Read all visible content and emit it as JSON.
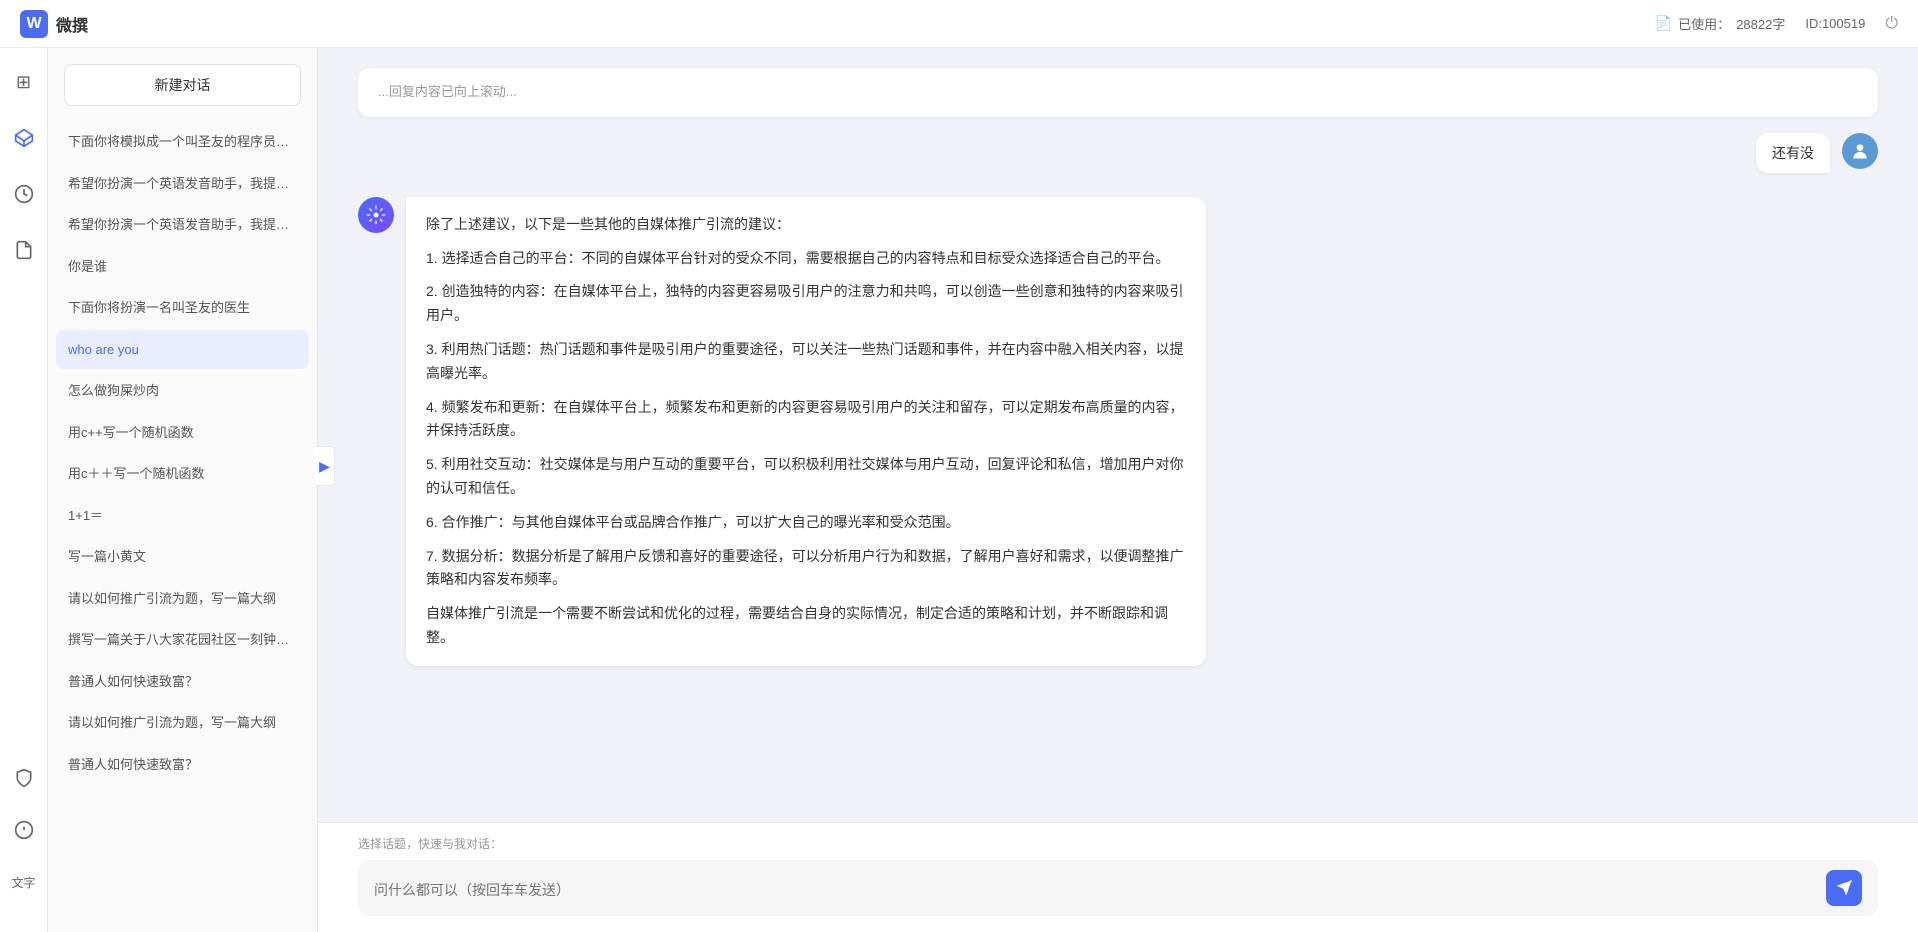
{
  "header": {
    "title": "微撰",
    "logo_letter": "W",
    "usage_label": "已使用：",
    "usage_value": "28822字",
    "id_label": "ID:100519"
  },
  "sidebar_icons": {
    "top": [
      {
        "name": "home-icon",
        "symbol": "⊞"
      },
      {
        "name": "cube-icon",
        "symbol": "◈"
      },
      {
        "name": "clock-icon",
        "symbol": "⏱"
      },
      {
        "name": "doc-icon",
        "symbol": "📄"
      }
    ],
    "bottom": [
      {
        "name": "shield-icon",
        "symbol": "🛡"
      },
      {
        "name": "info-icon",
        "symbol": "ℹ"
      },
      {
        "name": "bottom-text",
        "symbol": "文字"
      }
    ]
  },
  "conv_sidebar": {
    "new_btn": "新建对话",
    "items": [
      {
        "text": "下面你将模拟成一个叫圣友的程序员，我说...",
        "active": false
      },
      {
        "text": "希望你扮演一个英语发音助手，我提供给你...",
        "active": false
      },
      {
        "text": "希望你扮演一个英语发音助手，我提供给你...",
        "active": false
      },
      {
        "text": "你是谁",
        "active": false
      },
      {
        "text": "下面你将扮演一名叫圣友的医生",
        "active": false
      },
      {
        "text": "who are you",
        "active": true
      },
      {
        "text": "怎么做狗屎炒肉",
        "active": false
      },
      {
        "text": "用c++写一个随机函数",
        "active": false
      },
      {
        "text": "用c＋＋写一个随机函数",
        "active": false
      },
      {
        "text": "1+1＝",
        "active": false
      },
      {
        "text": "写一篇小黄文",
        "active": false
      },
      {
        "text": "请以如何推广引流为题，写一篇大纲",
        "active": false
      },
      {
        "text": "撰写一篇关于八大家花园社区一刻钟便民生...",
        "active": false
      },
      {
        "text": "普通人如何快速致富？",
        "active": false
      },
      {
        "text": "请以如何推广引流为题，写一篇大纲",
        "active": false
      },
      {
        "text": "普通人如何快速致富？",
        "active": false
      }
    ]
  },
  "chat": {
    "history_text": "除了上述建议，以下是一些其他的自媒体推广引流的建议：\n\n1. 选择适合自己的平台：不同的自媒体平台针对的受众不同，需要根据自己的内容特点和目标受众选择适合自己的平台。\n\n2. 创造独特的内容：在自媒体平台上，独特的内容更容易吸引用户的注意力和共鸣，可以创造一些创意和独特的内容来吸引用户。\n\n3. 利用热门话题：热门话题和事件是吸引用户的重要途径，可以关注一些热门话题和事件，并在内容中融入相关内容，以提高曝光率。\n\n4. 频繁发布和更新：在自媒体平台上，频繁发布和更新的内容更容易吸引用户的关注和留存，可以定期发布高质量的内容，并保持活跃度。\n\n5. 利用社交互动：社交媒体是与用户互动的重要平台，可以积极利用社交媒体与用户互动，回复评论和私信，增加用户对你的认可和信任。\n\n6. 合作推广：与其他自媒体平台或品牌合作推广，可以扩大自己的曝光率和受众范围。\n\n7. 数据分析：数据分析是了解用户反馈和喜好的重要途径，可以分析用户行为和数据，了解用户喜好和需求，以便调整推广策略和内容发布频率。\n\n自媒体推广引流是一个需要不断尝试和优化的过程，需要结合自身的实际情况，制定合适的策略和计划，并不断跟踪和调整。",
    "user_msg": "还有没",
    "quick_topics": "选择话题，快速与我对话：",
    "input_placeholder": "问什么都可以（按回车车发送）"
  }
}
